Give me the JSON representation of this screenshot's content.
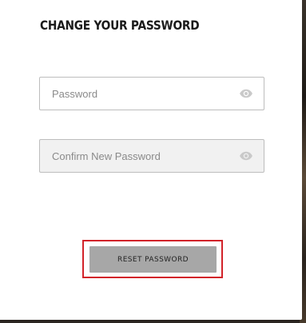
{
  "form": {
    "title": "CHANGE YOUR PASSWORD",
    "password_field": {
      "placeholder": "Password",
      "value": "",
      "icon": "eye-icon"
    },
    "confirm_field": {
      "placeholder": "Confirm New Password",
      "value": "",
      "icon": "eye-icon"
    },
    "submit_label": "RESET PASSWORD"
  },
  "colors": {
    "highlight_border": "#d2232a",
    "button_bg": "#a7a7a7",
    "title_text": "#1b1b1b"
  }
}
